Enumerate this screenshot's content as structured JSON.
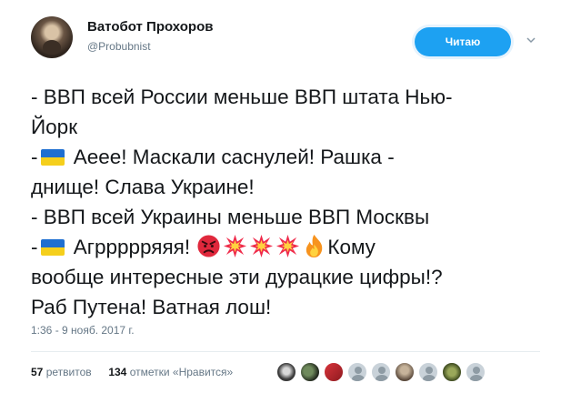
{
  "user": {
    "display_name": "Ватобот Прохоров",
    "handle": "@Probubnist"
  },
  "follow_button": {
    "label": "Читаю"
  },
  "tweet": {
    "line1": "- ВВП всей России меньше ВВП штата Нью-",
    "line2": "Йорк",
    "line3_prefix": "-",
    "line3_text": " Аеее! Маскали саснулей! Рашка -",
    "line4": "днище! Слава Украине!",
    "line5": "- ВВП всей Украины меньше ВВП Москвы",
    "line6_prefix": "-",
    "line6_text": " Агррррряяя! ",
    "line6_tail": "Кому",
    "line7": "вообще интересные эти дурацкие цифры!?",
    "line8": "Раб Путена! Ватная лош!"
  },
  "icons": {
    "flag": "ukraine-flag-icon",
    "angry": "angry-face-icon",
    "collision": "collision-icon",
    "fire": "fire-icon"
  },
  "timestamp": "1:36 - 9 нояб. 2017 г.",
  "stats": {
    "retweets_count": "57",
    "retweets_label": "ретвитов",
    "likes_count": "134",
    "likes_label": "отметки «Нравится»"
  },
  "colors": {
    "accent": "#1da1f2",
    "text": "#14171a",
    "muted": "#657786"
  }
}
